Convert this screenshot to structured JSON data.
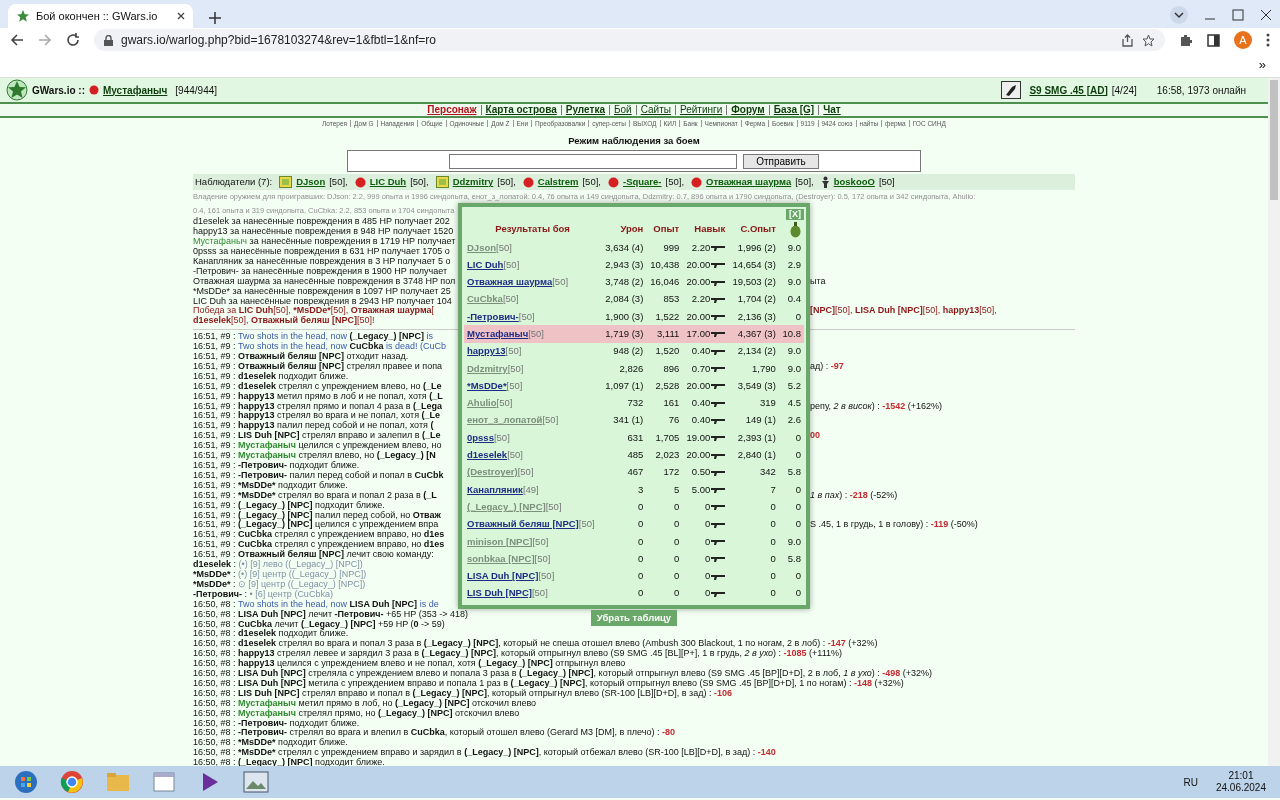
{
  "browser": {
    "tab_title": "Бой окончен :: GWars.io",
    "url": "gwars.io/warlog.php?bid=1678103274&rev=1&fbtl=1&nf=ro",
    "profile": "A",
    "bookmarks_more": "»"
  },
  "header": {
    "site": "GWars.io ::",
    "player": "Мустафаныч",
    "hp": "[944/944]",
    "weapon": "S9 SMG .45 [AD]",
    "ammo": "[4/24]",
    "status": "16:58, 1973 онлайн"
  },
  "nav": [
    {
      "label": "Персонаж",
      "selected": true,
      "bold": true
    },
    {
      "label": "Карта острова",
      "selected": false,
      "bold": true
    },
    {
      "label": "Рулетка",
      "selected": false,
      "bold": true
    },
    {
      "label": "Бой",
      "selected": false,
      "bold": false
    },
    {
      "label": "Сайты",
      "selected": false,
      "bold": false
    },
    {
      "label": "Рейтинги",
      "selected": false,
      "bold": false
    },
    {
      "label": "Форум",
      "selected": false,
      "bold": true
    },
    {
      "label": "База [G]",
      "selected": false,
      "bold": true
    },
    {
      "label": "Чат",
      "selected": false,
      "bold": true
    }
  ],
  "links": [
    "Лотерея",
    "Дом G",
    "Нападения",
    "Общие",
    "Одиночные",
    "Дом Z",
    "Ени",
    "Преобразовалки",
    "супер-сеты",
    "ВЫХОД",
    "КИЛ",
    "Банк",
    "Чемпионат",
    "Ферма",
    "Боевик",
    "9119",
    "9424 союз",
    "найты",
    "ферма",
    "ГОС СИНД"
  ],
  "watch": {
    "title": "Режим наблюдения за боем",
    "button": "Отправить"
  },
  "observers": {
    "label": "Наблюдатели (7):",
    "items": [
      {
        "name": "DJson",
        "rank": "[50],",
        "kind": "badge"
      },
      {
        "name": "LIC Duh",
        "rank": "[50],",
        "kind": "dot"
      },
      {
        "name": "Ddzmitry",
        "rank": "[50],",
        "kind": "badge"
      },
      {
        "name": "Calstrem",
        "rank": "[50],",
        "kind": "dot"
      },
      {
        "name": "-Square-",
        "rank": "[50],",
        "kind": "dot"
      },
      {
        "name": "Отважная шаурма",
        "rank": "[50],",
        "kind": "dot"
      },
      {
        "name": "boskooO",
        "rank": "[50]",
        "kind": "figure"
      }
    ]
  },
  "weapon_note": [
    "Владение оружием для проигравших: DJson: 2.2, 999 опыта и 1996 синдопыта, енот_з_лопатой: 0.4, 76 опыта и 149 синдопыта, Ddzmitry: 0.7, 896 опыта и 1790 синдопыта, (Destroyer): 0.5, 172 опыта и 342 синдопыта, Ahulio:",
    "0.4, 161 опыта и 319 синдопыта, CuCbka: 2.2, 853 опыта и 1704 синдопыта"
  ],
  "summary": [
    {
      "parts": [
        {
          "kind": "plain",
          "text": "d1eselek за нанесённые повреждения в 485 HP получает 202"
        }
      ]
    },
    {
      "parts": [
        {
          "kind": "plain",
          "text": "happy13 за нанесённые повреждения в 948 HP получает 1520"
        }
      ]
    },
    {
      "parts": [
        {
          "kind": "self",
          "text": "Мустафаныч"
        },
        {
          "kind": "plain",
          "text": " за нанесённые повреждения в 1719 HP получает"
        }
      ]
    },
    {
      "parts": [
        {
          "kind": "plain",
          "text": "0psss за нанесённые повреждения в 631 HP получает 1705 о"
        }
      ]
    },
    {
      "parts": [
        {
          "kind": "plain",
          "text": "Канапляник за нанесённые повреждения в 3 HP получает 5 о"
        }
      ]
    },
    {
      "parts": [
        {
          "kind": "plain",
          "text": "-Петрович- за нанесённые повреждения в 1900 HP получает"
        }
      ]
    },
    {
      "parts": [
        {
          "kind": "plain",
          "text": "Отважная шаурма за нанесённые повреждения в 3748 HP пол"
        }
      ],
      "tail": [
        {
          "kind": "plain",
          "text": "ыта"
        }
      ]
    },
    {
      "parts": [
        {
          "kind": "plain",
          "text": "*MsDDe* за нанесённые повреждения в 1097 HP получает 25"
        }
      ]
    },
    {
      "parts": [
        {
          "kind": "plain",
          "text": "LIC Duh за нанесённые повреждения в 2943 HP получает 104"
        }
      ]
    },
    {
      "parts": [
        {
          "kind": "win",
          "text": "Победа за "
        },
        {
          "kind": "win-bold",
          "text": "LIC Duh"
        },
        {
          "kind": "win",
          "text": "[50], "
        },
        {
          "kind": "win-bold",
          "text": "*MsDDe*"
        },
        {
          "kind": "win",
          "text": "[50], "
        },
        {
          "kind": "win-bold",
          "text": "Отважная шаурма"
        },
        {
          "kind": "win",
          "text": "["
        }
      ],
      "tail": [
        {
          "kind": "win-bold",
          "text": "[NPC]"
        },
        {
          "kind": "win",
          "text": "[50], "
        },
        {
          "kind": "win-bold",
          "text": "LISA Duh [NPC]"
        },
        {
          "kind": "win",
          "text": "[50], "
        },
        {
          "kind": "win-bold",
          "text": "happy13"
        },
        {
          "kind": "win",
          "text": "[50],"
        }
      ]
    },
    {
      "parts": [
        {
          "kind": "win-bold",
          "text": "d1eselek"
        },
        {
          "kind": "win",
          "text": "[50], "
        },
        {
          "kind": "win-bold",
          "text": "Отважный беляш [NPC]"
        },
        {
          "kind": "win",
          "text": "[50]!"
        }
      ]
    }
  ],
  "log": [
    {
      "time": "16:51, #9 :",
      "parts": [
        {
          "kind": "shot",
          "text": " Two shots in the head, now "
        },
        {
          "kind": "bold",
          "text": "(_Legacy_) [NPC]"
        },
        {
          "kind": "shot",
          "text": " is"
        }
      ]
    },
    {
      "time": "16:51, #9 :",
      "parts": [
        {
          "kind": "shot",
          "text": " Two shots in the head, now "
        },
        {
          "kind": "bold",
          "text": "CuCbka"
        },
        {
          "kind": "shot",
          "text": " is dead! (CuCb"
        }
      ]
    },
    {
      "time": "16:51, #9 :",
      "parts": [
        {
          "kind": "bold",
          "text": " Отважный беляш [NPC]"
        },
        {
          "kind": "plain",
          "text": " отходит назад."
        }
      ]
    },
    {
      "time": "16:51, #9 :",
      "parts": [
        {
          "kind": "bold",
          "text": " Отважный беляш [NPC]"
        },
        {
          "kind": "plain",
          "text": " стрелял правее и попа"
        }
      ],
      "tail": [
        {
          "kind": "plain",
          "text": "ад) : "
        },
        {
          "kind": "damage",
          "text": "-97"
        }
      ]
    },
    {
      "time": "16:51, #9 :",
      "parts": [
        {
          "kind": "bold",
          "text": " d1eselek"
        },
        {
          "kind": "plain",
          "text": " подходит ближе."
        }
      ]
    },
    {
      "time": "16:51, #9 :",
      "parts": [
        {
          "kind": "bold",
          "text": " d1eselek"
        },
        {
          "kind": "plain",
          "text": " стрелял с упреждением влево, но "
        },
        {
          "kind": "bold",
          "text": "(_Le"
        }
      ]
    },
    {
      "time": "16:51, #9 :",
      "parts": [
        {
          "kind": "bold",
          "text": " happy13"
        },
        {
          "kind": "plain",
          "text": " метил прямо в лоб и не попал, хотя "
        },
        {
          "kind": "bold",
          "text": "(_L"
        }
      ]
    },
    {
      "time": "16:51, #9 :",
      "parts": [
        {
          "kind": "bold",
          "text": " happy13"
        },
        {
          "kind": "plain",
          "text": " стрелял прямо и попал 4 раза в "
        },
        {
          "kind": "bold",
          "text": "(_Lega"
        }
      ],
      "tail": [
        {
          "kind": "plain",
          "text": "репу, "
        },
        {
          "kind": "italic",
          "text": "2 в висок"
        },
        {
          "kind": "plain",
          "text": ") : "
        },
        {
          "kind": "damage",
          "text": "-1542"
        },
        {
          "kind": "plain",
          "text": " (+162%)"
        }
      ]
    },
    {
      "time": "16:51, #9 :",
      "parts": [
        {
          "kind": "bold",
          "text": " happy13"
        },
        {
          "kind": "plain",
          "text": " стрелял во врага и не попал, хотя "
        },
        {
          "kind": "bold",
          "text": "(_Le"
        }
      ]
    },
    {
      "time": "16:51, #9 :",
      "parts": [
        {
          "kind": "bold",
          "text": " happy13"
        },
        {
          "kind": "plain",
          "text": " палил перед собой и не попал, хотя "
        },
        {
          "kind": "bold",
          "text": "("
        }
      ]
    },
    {
      "time": "16:51, #9 :",
      "parts": [
        {
          "kind": "bold",
          "text": " LIS Duh [NPC]"
        },
        {
          "kind": "plain",
          "text": " стрелял вправо и залепил в "
        },
        {
          "kind": "bold",
          "text": "(_Le"
        }
      ],
      "tail": [
        {
          "kind": "damage",
          "text": "00"
        }
      ]
    },
    {
      "time": "16:51, #9 :",
      "parts": [
        {
          "kind": "self-bold",
          "text": " Мустафаныч"
        },
        {
          "kind": "plain",
          "text": " целился с упреждением влево, но"
        }
      ]
    },
    {
      "time": "16:51, #9 :",
      "parts": [
        {
          "kind": "self-bold",
          "text": " Мустафаныч"
        },
        {
          "kind": "plain",
          "text": " стрелял влево, но "
        },
        {
          "kind": "bold",
          "text": "(_Legacy_) [N"
        }
      ]
    },
    {
      "time": "16:51, #9 :",
      "parts": [
        {
          "kind": "bold",
          "text": " -Петрович-"
        },
        {
          "kind": "plain",
          "text": " подходит ближе."
        }
      ]
    },
    {
      "time": "16:51, #9 :",
      "parts": [
        {
          "kind": "bold",
          "text": " -Петрович-"
        },
        {
          "kind": "plain",
          "text": " палил перед собой и попал в "
        },
        {
          "kind": "bold",
          "text": "CuCbk"
        }
      ]
    },
    {
      "time": "16:51, #9 :",
      "parts": [
        {
          "kind": "bold",
          "text": " *MsDDe*"
        },
        {
          "kind": "plain",
          "text": " подходит ближе."
        }
      ]
    },
    {
      "time": "16:51, #9 :",
      "parts": [
        {
          "kind": "bold",
          "text": " *MsDDe*"
        },
        {
          "kind": "plain",
          "text": " стрелял во врага и попал 2 раза в "
        },
        {
          "kind": "bold",
          "text": "(_L"
        }
      ],
      "tail": [
        {
          "kind": "italic",
          "text": "1 в пах"
        },
        {
          "kind": "plain",
          "text": ") : "
        },
        {
          "kind": "damage",
          "text": "-218"
        },
        {
          "kind": "plain",
          "text": " (-52%)"
        }
      ]
    },
    {
      "time": "16:51, #9 :",
      "parts": [
        {
          "kind": "bold",
          "text": " (_Legacy_) [NPC]"
        },
        {
          "kind": "plain",
          "text": " подходит ближе."
        }
      ]
    },
    {
      "time": "16:51, #9 :",
      "parts": [
        {
          "kind": "bold",
          "text": " (_Legacy_) [NPC]"
        },
        {
          "kind": "plain",
          "text": " палил перед собой, но "
        },
        {
          "kind": "bold",
          "text": "Отваж"
        }
      ]
    },
    {
      "time": "16:51, #9 :",
      "parts": [
        {
          "kind": "bold",
          "text": " (_Legacy_) [NPC]"
        },
        {
          "kind": "plain",
          "text": " целился с упреждением впра"
        }
      ],
      "tail": [
        {
          "kind": "plain",
          "text": "S .45, 1 в грудь, 1 в голову) : "
        },
        {
          "kind": "damage",
          "text": "-119"
        },
        {
          "kind": "plain",
          "text": " (-50%)"
        }
      ]
    },
    {
      "time": "16:51, #9 :",
      "parts": [
        {
          "kind": "bold",
          "text": " CuCbka"
        },
        {
          "kind": "plain",
          "text": " стрелял с упреждением вправо, но "
        },
        {
          "kind": "bold",
          "text": "d1es"
        }
      ]
    },
    {
      "time": "16:51, #9 :",
      "parts": [
        {
          "kind": "bold",
          "text": " CuCbka"
        },
        {
          "kind": "plain",
          "text": " стрелял с упреждением вправо, но "
        },
        {
          "kind": "bold",
          "text": "d1es"
        }
      ]
    },
    {
      "time": "16:51, #9 :",
      "parts": [
        {
          "kind": "bold",
          "text": " Отважный беляш [NPC]"
        },
        {
          "kind": "plain",
          "text": " лечит свою команду:"
        }
      ]
    },
    {
      "parts": [
        {
          "kind": "bold",
          "text": "d1eselek"
        },
        {
          "kind": "plain",
          "text": " : "
        },
        {
          "kind": "muted",
          "text": "(•) [9] лево ((_Legacy_) [NPC])"
        }
      ]
    },
    {
      "parts": [
        {
          "kind": "bold",
          "text": "*MsDDe*"
        },
        {
          "kind": "plain",
          "text": " : "
        },
        {
          "kind": "muted",
          "text": "(•) [9] центр ((_Legacy_) [NPC])"
        }
      ]
    },
    {
      "parts": [
        {
          "kind": "bold",
          "text": "*MsDDe*"
        },
        {
          "kind": "plain",
          "text": " : "
        },
        {
          "kind": "muted",
          "text": "⊙ [9] центр ((_Legacy_) [NPC])"
        }
      ]
    },
    {
      "parts": [
        {
          "kind": "bold",
          "text": "-Петрович-"
        },
        {
          "kind": "plain",
          "text": " : "
        },
        {
          "kind": "muted",
          "text": "• [6] центр (CuCbka)"
        }
      ]
    },
    {
      "time": "16:50, #8 :",
      "parts": [
        {
          "kind": "shot",
          "text": " Two shots in the head, now "
        },
        {
          "kind": "bold",
          "text": "LISA Duh [NPC]"
        },
        {
          "kind": "shot",
          "text": " is de"
        }
      ]
    },
    {
      "time": "16:50, #8 :",
      "parts": [
        {
          "kind": "bold",
          "text": " LISA Duh [NPC]"
        },
        {
          "kind": "plain",
          "text": " лечит "
        },
        {
          "kind": "bold",
          "text": "-Петрович-"
        },
        {
          "kind": "plain",
          "text": " +65 HP (353 -> 418)"
        }
      ]
    },
    {
      "time": "16:50, #8 :",
      "parts": [
        {
          "kind": "bold",
          "text": " CuCbka"
        },
        {
          "kind": "plain",
          "text": " лечит "
        },
        {
          "kind": "bold",
          "text": "(_Legacy_) [NPC]"
        },
        {
          "kind": "plain",
          "text": " +59 HP ("
        },
        {
          "kind": "bold",
          "text": "0"
        },
        {
          "kind": "plain",
          "text": " -> 59)"
        }
      ]
    },
    {
      "time": "16:50, #8 :",
      "parts": [
        {
          "kind": "bold",
          "text": " d1eselek"
        },
        {
          "kind": "plain",
          "text": " подходит ближе."
        }
      ]
    },
    {
      "time": "16:50, #8 :",
      "parts": [
        {
          "kind": "bold",
          "text": " d1eselek"
        },
        {
          "kind": "plain",
          "text": " стрелял во врага и попал 3 раза в "
        },
        {
          "kind": "bold",
          "text": "(_Legacy_) [NPC]"
        },
        {
          "kind": "plain",
          "text": ", который не спеша отошел влево (Ambush 300 Blackout, 1 по ногам, 2 в лоб) : "
        },
        {
          "kind": "damage",
          "text": "-147"
        },
        {
          "kind": "plain",
          "text": " (+32%)"
        }
      ]
    },
    {
      "time": "16:50, #8 :",
      "parts": [
        {
          "kind": "bold",
          "text": " happy13"
        },
        {
          "kind": "plain",
          "text": " стрелял левее и зарядил 3 раза в "
        },
        {
          "kind": "bold",
          "text": "(_Legacy_) [NPC]"
        },
        {
          "kind": "plain",
          "text": ", который отпрыгнул влево (S9 SMG .45 [BL][P+], 1 в грудь, "
        },
        {
          "kind": "italic",
          "text": "2 в ухо"
        },
        {
          "kind": "plain",
          "text": ") : "
        },
        {
          "kind": "damage",
          "text": "-1085"
        },
        {
          "kind": "plain",
          "text": " (+111%)"
        }
      ]
    },
    {
      "time": "16:50, #8 :",
      "parts": [
        {
          "kind": "bold",
          "text": " happy13"
        },
        {
          "kind": "plain",
          "text": " целился с упреждением влево и не попал, хотя "
        },
        {
          "kind": "bold",
          "text": "(_Legacy_) [NPC]"
        },
        {
          "kind": "plain",
          "text": " отпрыгнул влево"
        }
      ]
    },
    {
      "time": "16:50, #8 :",
      "parts": [
        {
          "kind": "bold",
          "text": " LISA Duh [NPC]"
        },
        {
          "kind": "plain",
          "text": " стреляла с упреждением влево и попала 3 раза в "
        },
        {
          "kind": "bold",
          "text": "(_Legacy_) [NPC]"
        },
        {
          "kind": "plain",
          "text": ", который отпрыгнул влево (S9 SMG .45 [BP][D+D], 2 в лоб, "
        },
        {
          "kind": "italic",
          "text": "1 в ухо"
        },
        {
          "kind": "plain",
          "text": ") : "
        },
        {
          "kind": "damage",
          "text": "-498"
        },
        {
          "kind": "plain",
          "text": " (+32%)"
        }
      ]
    },
    {
      "time": "16:50, #8 :",
      "parts": [
        {
          "kind": "bold",
          "text": " LISA Duh [NPC]"
        },
        {
          "kind": "plain",
          "text": " метила с упреждением вправо и попала 1 раз в "
        },
        {
          "kind": "bold",
          "text": "(_Legacy_) [NPC]"
        },
        {
          "kind": "plain",
          "text": ", который отпрыгнул влево (S9 SMG .45 [BP][D+D], 1 по ногам) : "
        },
        {
          "kind": "damage",
          "text": "-148"
        },
        {
          "kind": "plain",
          "text": " (+32%)"
        }
      ]
    },
    {
      "time": "16:50, #8 :",
      "parts": [
        {
          "kind": "bold",
          "text": " LIS Duh [NPC]"
        },
        {
          "kind": "plain",
          "text": " стрелял вправо и попал в "
        },
        {
          "kind": "bold",
          "text": "(_Legacy_) [NPC]"
        },
        {
          "kind": "plain",
          "text": ", который отпрыгнул влево (SR-100 [LB][D+D], в зад) : "
        },
        {
          "kind": "damage",
          "text": "-106"
        }
      ]
    },
    {
      "time": "16:50, #8 :",
      "parts": [
        {
          "kind": "self-bold",
          "text": " Мустафаныч"
        },
        {
          "kind": "plain",
          "text": " метил прямо в лоб, но "
        },
        {
          "kind": "bold",
          "text": "(_Legacy_) [NPC]"
        },
        {
          "kind": "plain",
          "text": " отскочил влево"
        }
      ]
    },
    {
      "time": "16:50, #8 :",
      "parts": [
        {
          "kind": "self-bold",
          "text": " Мустафаныч"
        },
        {
          "kind": "plain",
          "text": " стрелял прямо, но "
        },
        {
          "kind": "bold",
          "text": "(_Legacy_) [NPC]"
        },
        {
          "kind": "plain",
          "text": " отскочил влево"
        }
      ]
    },
    {
      "time": "16:50, #8 :",
      "parts": [
        {
          "kind": "bold",
          "text": " -Петрович-"
        },
        {
          "kind": "plain",
          "text": " подходит ближе."
        }
      ]
    },
    {
      "time": "16:50, #8 :",
      "parts": [
        {
          "kind": "bold",
          "text": " -Петрович-"
        },
        {
          "kind": "plain",
          "text": " стрелял во врага и влепил в "
        },
        {
          "kind": "bold",
          "text": "CuCbka"
        },
        {
          "kind": "plain",
          "text": ", который отошел влево (Gerard M3 [DM], в плечо) : "
        },
        {
          "kind": "damage",
          "text": "-80"
        }
      ]
    },
    {
      "time": "16:50, #8 :",
      "parts": [
        {
          "kind": "bold",
          "text": " *MsDDe*"
        },
        {
          "kind": "plain",
          "text": " подходит ближе."
        }
      ]
    },
    {
      "time": "16:50, #8 :",
      "parts": [
        {
          "kind": "bold",
          "text": " *MsDDe*"
        },
        {
          "kind": "plain",
          "text": " стрелял с упреждением вправо и зарядил в "
        },
        {
          "kind": "bold",
          "text": "(_Legacy_) [NPC]"
        },
        {
          "kind": "plain",
          "text": ", который отбежал влево (SR-100 [LB][D+D], в зад) : "
        },
        {
          "kind": "damage",
          "text": "-140"
        }
      ]
    },
    {
      "time": "16:50, #8 :",
      "parts": [
        {
          "kind": "bold",
          "text": " (_Legacy_) [NPC]"
        },
        {
          "kind": "plain",
          "text": " подходит ближе."
        }
      ]
    }
  ],
  "results": {
    "close": "[X]",
    "columns": [
      "Результаты боя",
      "Урон",
      "Опыт",
      "Навык",
      "С.Опыт"
    ],
    "hide_button": "Убрать таблицу",
    "rows": [
      {
        "name": "DJson",
        "rank": "[50]",
        "damage": "3,634 (4)",
        "exp": "999",
        "skill": "2.20",
        "syn": "1,996 (2)",
        "column_6": "9.0",
        "defeated": true,
        "selected": false
      },
      {
        "name": "LIC Duh",
        "rank": "[50]",
        "damage": "2,943 (3)",
        "exp": "10,438",
        "skill": "20.00",
        "syn": "14,654 (3)",
        "column_6": "2.9",
        "defeated": false,
        "selected": false
      },
      {
        "name": "Отважная шаурма",
        "rank": "[50]",
        "damage": "3,748 (2)",
        "exp": "16,046",
        "skill": "20.00",
        "syn": "19,503 (2)",
        "column_6": "9.0",
        "defeated": false,
        "selected": false
      },
      {
        "name": "CuCbka",
        "rank": "[50]",
        "damage": "2,084 (3)",
        "exp": "853",
        "skill": "2.20",
        "syn": "1,704 (2)",
        "column_6": "0.4",
        "defeated": true,
        "selected": false
      },
      {
        "name": "-Петрович-",
        "rank": "[50]",
        "damage": "1,900 (3)",
        "exp": "1,522",
        "skill": "20.00",
        "syn": "2,136 (3)",
        "column_6": "0",
        "defeated": false,
        "selected": false
      },
      {
        "name": "Мустафаныч",
        "rank": "[50]",
        "damage": "1,719 (3)",
        "exp": "3,111",
        "skill": "17.00",
        "syn": "4,367 (3)",
        "column_6": "10.8",
        "defeated": false,
        "selected": true
      },
      {
        "name": "happy13",
        "rank": "[50]",
        "damage": "948 (2)",
        "exp": "1,520",
        "skill": "0.40",
        "syn": "2,134 (2)",
        "column_6": "9.0",
        "defeated": false,
        "selected": false
      },
      {
        "name": "Ddzmitry",
        "rank": "[50]",
        "damage": "2,826",
        "exp": "896",
        "skill": "0.70",
        "syn": "1,790",
        "column_6": "9.0",
        "defeated": true,
        "selected": false
      },
      {
        "name": "*MsDDe*",
        "rank": "[50]",
        "damage": "1,097 (1)",
        "exp": "2,528",
        "skill": "20.00",
        "syn": "3,549 (3)",
        "column_6": "5.2",
        "defeated": false,
        "selected": false
      },
      {
        "name": "Ahulio",
        "rank": "[50]",
        "damage": "732",
        "exp": "161",
        "skill": "0.40",
        "syn": "319",
        "column_6": "4.5",
        "defeated": true,
        "selected": false
      },
      {
        "name": "енот_з_лопатой",
        "rank": "[50]",
        "damage": "341 (1)",
        "exp": "76",
        "skill": "0.40",
        "syn": "149 (1)",
        "column_6": "2.6",
        "defeated": true,
        "selected": false
      },
      {
        "name": "0psss",
        "rank": "[50]",
        "damage": "631",
        "exp": "1,705",
        "skill": "19.00",
        "syn": "2,393 (1)",
        "column_6": "0",
        "defeated": false,
        "selected": false
      },
      {
        "name": "d1eselek",
        "rank": "[50]",
        "damage": "485",
        "exp": "2,023",
        "skill": "20.00",
        "syn": "2,840 (1)",
        "column_6": "0",
        "defeated": false,
        "selected": false
      },
      {
        "name": "(Destroyer)",
        "rank": "[50]",
        "damage": "467",
        "exp": "172",
        "skill": "0.50",
        "syn": "342",
        "column_6": "5.8",
        "defeated": true,
        "selected": false
      },
      {
        "name": "Канапляник",
        "rank": "[49]",
        "damage": "3",
        "exp": "5",
        "skill": "5.00",
        "syn": "7",
        "column_6": "0",
        "defeated": false,
        "selected": false
      },
      {
        "name": "(_Legacy_) [NPC]",
        "rank": "[50]",
        "damage": "0",
        "exp": "0",
        "skill": "0",
        "syn": "0",
        "column_6": "0",
        "defeated": true,
        "selected": false
      },
      {
        "name": "Отважный беляш [NPC]",
        "rank": "[50]",
        "damage": "0",
        "exp": "0",
        "skill": "0",
        "syn": "0",
        "column_6": "0",
        "defeated": false,
        "selected": false
      },
      {
        "name": "minison [NPC]",
        "rank": "[50]",
        "damage": "0",
        "exp": "0",
        "skill": "0",
        "syn": "0",
        "column_6": "9.0",
        "defeated": true,
        "selected": false
      },
      {
        "name": "sonbkaa [NPC]",
        "rank": "[50]",
        "damage": "0",
        "exp": "0",
        "skill": "0",
        "syn": "0",
        "column_6": "5.8",
        "defeated": true,
        "selected": false
      },
      {
        "name": "LISA Duh [NPC]",
        "rank": "[50]",
        "damage": "0",
        "exp": "0",
        "skill": "0",
        "syn": "0",
        "column_6": "0",
        "defeated": false,
        "selected": false
      },
      {
        "name": "LIS Duh [NPC]",
        "rank": "[50]",
        "damage": "0",
        "exp": "0",
        "skill": "0",
        "syn": "0",
        "column_6": "0",
        "defeated": false,
        "selected": false
      }
    ]
  },
  "taskbar": {
    "language": "RU",
    "time": "21:01",
    "date": "24.06.2024"
  }
}
